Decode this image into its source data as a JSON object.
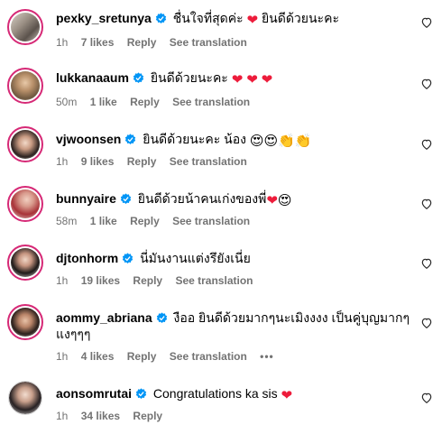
{
  "comments": [
    {
      "username": "pexky_sretunya",
      "text": "ชื่นใจที่สุดค่ะ",
      "text2": "ยินดีด้วยนะคะ",
      "time": "1h",
      "likes": "7 likes",
      "reply": "Reply",
      "translate": "See translation"
    },
    {
      "username": "lukkanaaum",
      "text": "ยินดีด้วยนะคะ",
      "time": "50m",
      "likes": "1 like",
      "reply": "Reply",
      "translate": "See translation"
    },
    {
      "username": "vjwoonsen",
      "text": "ยินดีด้วยนะคะ น้อง",
      "time": "1h",
      "likes": "9 likes",
      "reply": "Reply",
      "translate": "See translation"
    },
    {
      "username": "bunnyaire",
      "text": "ยินดีด้วยน้าคนเก่งของพี่",
      "time": "58m",
      "likes": "1 like",
      "reply": "Reply",
      "translate": "See translation"
    },
    {
      "username": "djtonhorm",
      "text": "นี่มันงานแต่งรึยังเนี่ย",
      "time": "1h",
      "likes": "19 likes",
      "reply": "Reply",
      "translate": "See translation"
    },
    {
      "username": "aommy_abriana",
      "text": "งืออ ยินดีด้วยมากๆนะเมิงงงง เป็นคู่บุญมากๆ",
      "text_line2": "แงๆๆๆ",
      "time": "1h",
      "likes": "4 likes",
      "reply": "Reply",
      "translate": "See translation",
      "more": "•••"
    },
    {
      "username": "aonsomrutai",
      "text": "Congratulations ka sis",
      "time": "1h",
      "likes": "34 likes",
      "reply": "Reply"
    }
  ],
  "icons": {
    "verified": "verified-badge-icon",
    "like": "heart-outline-icon"
  },
  "colors": {
    "verified": "#0095f6",
    "heart": "#ed1c3b",
    "meta": "#737373"
  }
}
